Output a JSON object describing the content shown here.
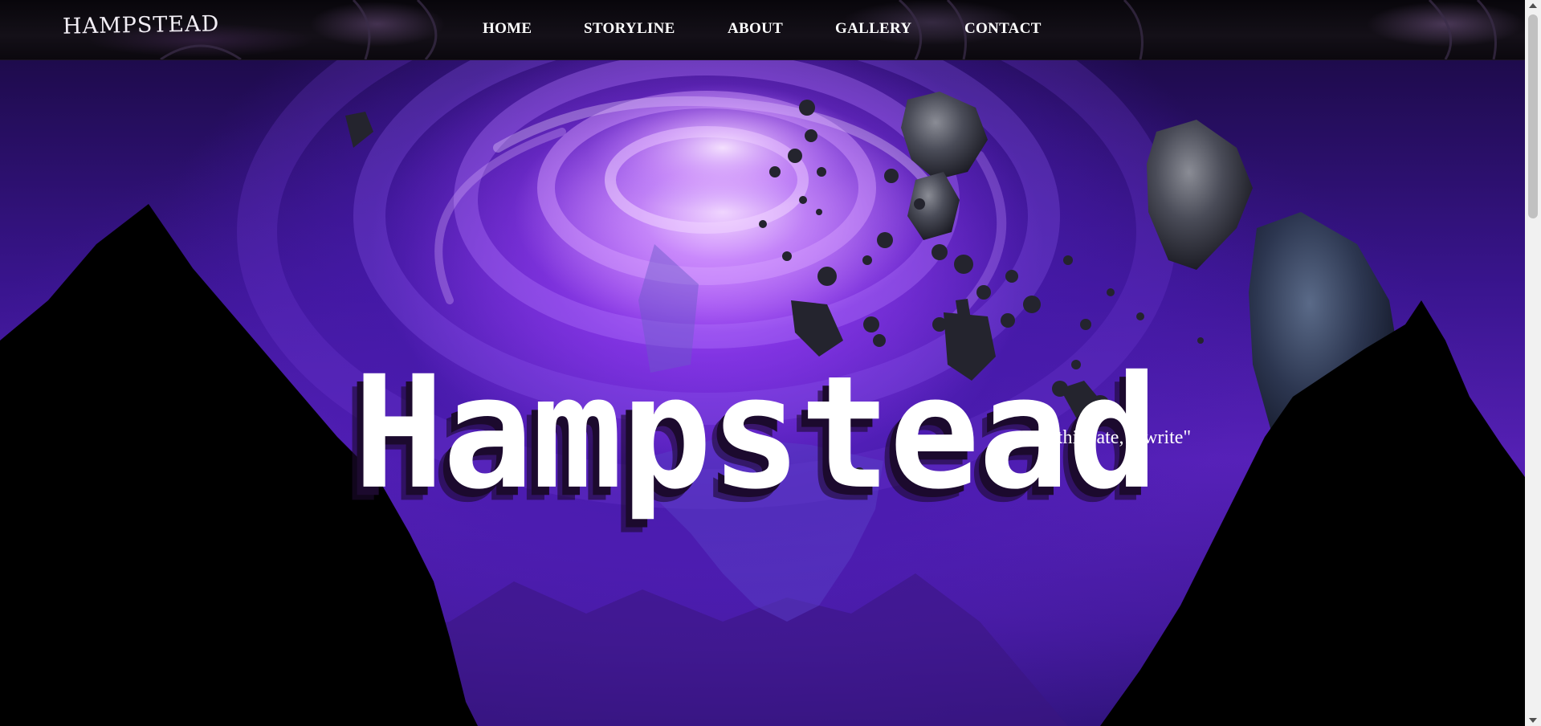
{
  "header": {
    "logo": "HAMPSTEAD",
    "nav": [
      "HOME",
      "STORYLINE",
      "ABOUT",
      "GALLERY",
      "CONTACT"
    ]
  },
  "hero": {
    "title": "Hampstead",
    "tagline": "\"this fate, rewrite\""
  },
  "colors": {
    "header_bg": "#0b080e",
    "vortex_light": "#f4dcff",
    "vortex_purple": "#6a26d0",
    "deep_violet": "#26106a",
    "mountain": "#000000",
    "title_text": "#ffffff",
    "title_shadow": "#1c0a2e"
  },
  "icons": [
    "scroll-up-arrow-icon",
    "scroll-down-arrow-icon"
  ]
}
